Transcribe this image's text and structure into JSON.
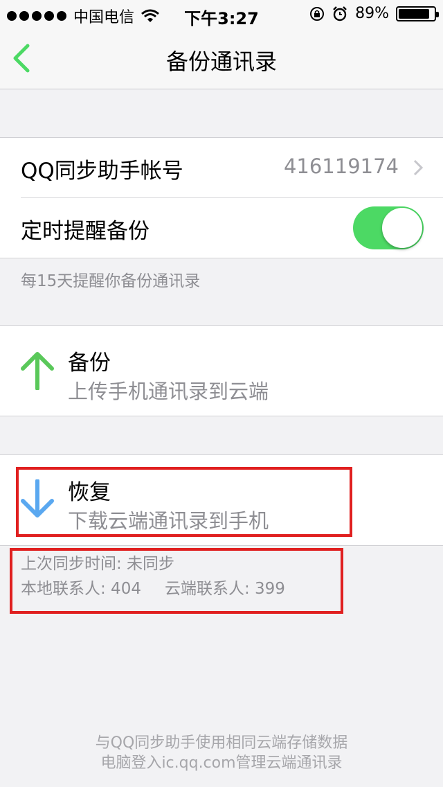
{
  "status_bar": {
    "carrier": "中国电信",
    "time": "下午3:27",
    "battery_percent": "89%",
    "battery_level": 0.89
  },
  "nav": {
    "title": "备份通讯录"
  },
  "settings": {
    "account_label": "QQ同步助手帐号",
    "account_value": "416119174",
    "reminder_label": "定时提醒备份",
    "reminder_on": true,
    "reminder_note": "每15天提醒你备份通讯录"
  },
  "backup": {
    "title": "备份",
    "subtitle": "上传手机通讯录到云端"
  },
  "restore": {
    "title": "恢复",
    "subtitle": "下载云端通讯录到手机"
  },
  "sync_info": {
    "last_sync": "上次同步时间: 未同步",
    "local_contacts": "本地联系人: 404",
    "cloud_contacts": "云端联系人: 399"
  },
  "footer": {
    "line1": "与QQ同步助手使用相同云端存储数据",
    "line2": "电脑登入ic.qq.com管理云端通讯录"
  },
  "colors": {
    "accent_green": "#4cd964",
    "upload_arrow": "#5ac85a",
    "download_arrow": "#5aa8f0",
    "highlight_red": "#e02020"
  },
  "icons": {
    "back": "back-chevron-icon",
    "upload": "arrow-up-icon",
    "download": "arrow-down-icon"
  }
}
